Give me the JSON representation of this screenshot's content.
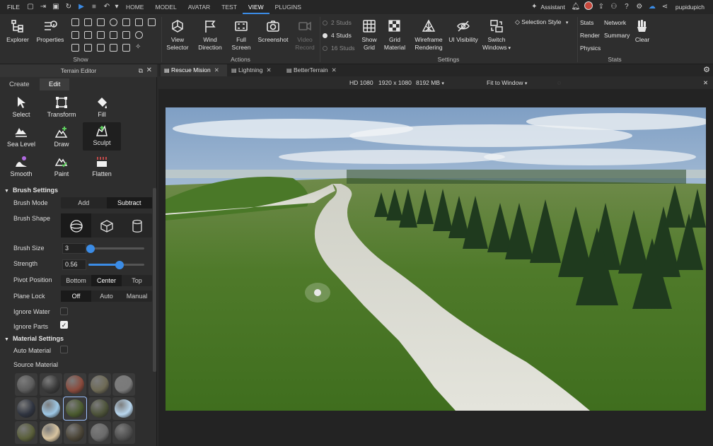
{
  "topbar": {
    "file_label": "FILE",
    "menu_tabs": [
      "HOME",
      "MODEL",
      "AVATAR",
      "TEST",
      "VIEW",
      "PLUGINS"
    ],
    "assistant_label": "Assistant",
    "username": "pupidupich"
  },
  "ribbon": {
    "show": {
      "explorer": "Explorer",
      "properties": "Properties",
      "section_label": "Show"
    },
    "actions": {
      "view_selector": [
        "View",
        "Selector"
      ],
      "wind_direction": [
        "Wind",
        "Direction"
      ],
      "full_screen": [
        "Full",
        "Screen"
      ],
      "screenshot": "Screenshot",
      "video_record": [
        "Video",
        "Record"
      ],
      "section_label": "Actions"
    },
    "settings": {
      "studs": [
        "2 Studs",
        "4 Studs",
        "16 Studs"
      ],
      "selected_stud": "4 Studs",
      "show_grid": [
        "Show",
        "Grid"
      ],
      "grid_material": [
        "Grid",
        "Material"
      ],
      "wireframe": [
        "Wireframe",
        "Rendering"
      ],
      "ui_visibility": "UI Visibility",
      "switch_windows": [
        "Switch",
        "Windows"
      ],
      "selection_style": "Selection Style",
      "section_label": "Settings"
    },
    "stats": {
      "stats": "Stats",
      "render": "Render",
      "physics": "Physics",
      "network": "Network",
      "summary": "Summary",
      "clear": "Clear",
      "section_label": "Stats"
    }
  },
  "terrain_editor": {
    "title": "Terrain Editor",
    "tabs": [
      "Create",
      "Edit"
    ],
    "active_tab": "Edit",
    "tools": [
      {
        "label": "Select",
        "icon": "cursor-icon"
      },
      {
        "label": "Transform",
        "icon": "transform-icon"
      },
      {
        "label": "Fill",
        "icon": "paint-bucket-icon"
      },
      {
        "label": "Sea Level",
        "icon": "sea-level-icon"
      },
      {
        "label": "Draw",
        "icon": "draw-icon"
      },
      {
        "label": "Sculpt",
        "icon": "sculpt-icon"
      },
      {
        "label": "Smooth",
        "icon": "smooth-icon"
      },
      {
        "label": "Paint",
        "icon": "paint-icon"
      },
      {
        "label": "Flatten",
        "icon": "flatten-icon"
      }
    ],
    "selected_tool": "Sculpt",
    "brush_settings": {
      "header": "Brush Settings",
      "brush_mode_label": "Brush Mode",
      "brush_mode_options": [
        "Add",
        "Subtract"
      ],
      "brush_mode_selected": "Subtract",
      "brush_shape_label": "Brush Shape",
      "brush_shapes": [
        "sphere-icon",
        "cube-icon",
        "cylinder-icon"
      ],
      "brush_size_label": "Brush Size",
      "brush_size_value": "3",
      "brush_size_fraction": 0.0,
      "strength_label": "Strength",
      "strength_value": "0.56",
      "strength_fraction": 0.56,
      "pivot_label": "Pivot Position",
      "pivot_options": [
        "Bottom",
        "Center",
        "Top"
      ],
      "pivot_selected": "Center",
      "plane_lock_label": "Plane Lock",
      "plane_lock_options": [
        "Off",
        "Auto",
        "Manual"
      ],
      "plane_lock_selected": "Off",
      "ignore_water_label": "Ignore Water",
      "ignore_water": false,
      "ignore_parts_label": "Ignore Parts",
      "ignore_parts": true
    },
    "material_settings": {
      "header": "Material Settings",
      "auto_material_label": "Auto Material",
      "auto_material": false,
      "source_material_label": "Source Material",
      "materials": [
        {
          "name": "asphalt",
          "color": "#5c5c5c"
        },
        {
          "name": "basalt",
          "color": "#3a3a3a"
        },
        {
          "name": "brick",
          "color": "#8a4a3c"
        },
        {
          "name": "cobblestone",
          "color": "#6e6a55"
        },
        {
          "name": "concrete",
          "color": "#7a7a7a"
        },
        {
          "name": "cracked-lava",
          "color": "#2f3440"
        },
        {
          "name": "glacier",
          "color": "#9ec8e6"
        },
        {
          "name": "grass",
          "color": "#4a5a2e"
        },
        {
          "name": "ground",
          "color": "#4c5238"
        },
        {
          "name": "ice",
          "color": "#b8d6ee"
        },
        {
          "name": "leafy-grass",
          "color": "#5a5f3a"
        },
        {
          "name": "limestone",
          "color": "#d8c4a0"
        },
        {
          "name": "mud",
          "color": "#4a4436"
        },
        {
          "name": "pavement",
          "color": "#6a6a6a"
        },
        {
          "name": "rock",
          "color": "#4e4e4e"
        }
      ],
      "selected_material": "grass"
    }
  },
  "document_tabs": [
    {
      "label": "Rescue Mision",
      "icon": "script-icon",
      "active": true
    },
    {
      "label": "Lightning",
      "icon": "script-icon",
      "active": false
    },
    {
      "label": "BetterTerrain",
      "icon": "script-icon",
      "active": false
    }
  ],
  "view_bar": {
    "device": "HD 1080",
    "resolution": "1920 x 1080",
    "memory": "8192 MB",
    "fit": "Fit to Window"
  },
  "colors": {
    "accent": "#3b8ce6",
    "panel_bg": "#2e2e2e",
    "topbar_bg": "#262626"
  }
}
